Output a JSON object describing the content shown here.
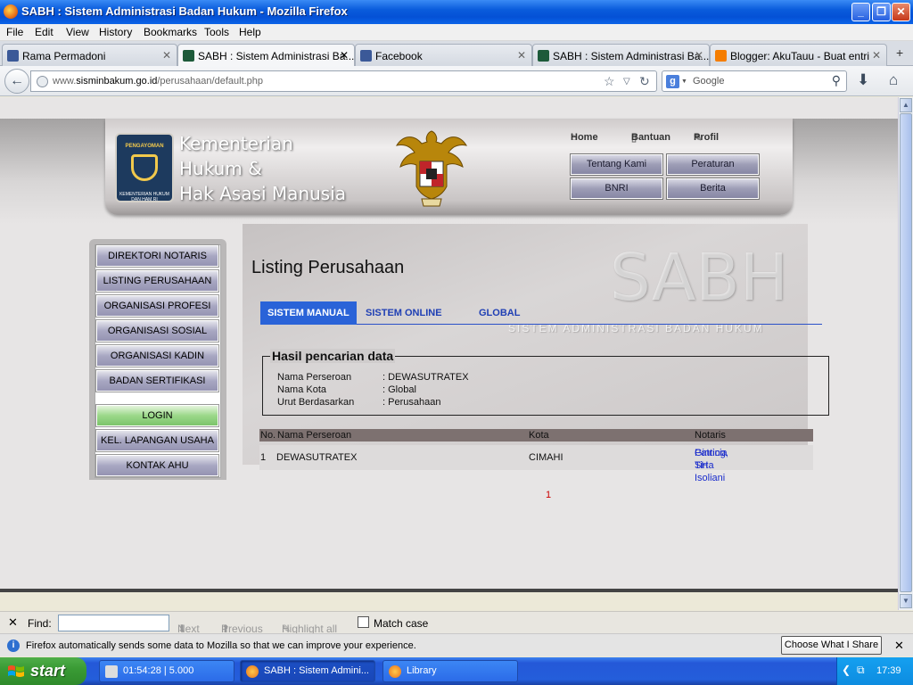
{
  "window": {
    "title": "SABH : Sistem Administrasi Badan Hukum - Mozilla Firefox"
  },
  "menu": [
    "File",
    "Edit",
    "View",
    "History",
    "Bookmarks",
    "Tools",
    "Help"
  ],
  "tabs": [
    {
      "label": "Rama Permadoni",
      "icon": "facebook-icon"
    },
    {
      "label": "SABH : Sistem Administrasi Ba...",
      "icon": "sabh-icon",
      "active": true
    },
    {
      "label": "Facebook",
      "icon": "facebook-icon"
    },
    {
      "label": "SABH : Sistem Administrasi Ba...",
      "icon": "sabh-icon"
    },
    {
      "label": "Blogger: AkuTauu - Buat entri",
      "icon": "blogger-icon"
    }
  ],
  "nav": {
    "url_prefix": "www.",
    "url_domain": "sisminbakum.go.id",
    "url_path": "/perusahaan/default.php",
    "search_placeholder": "Google"
  },
  "site": {
    "title_line1": "Kementerian",
    "title_line2": "Hukum &",
    "title_line3": "Hak Asasi Manusia",
    "logo_top": "PENGAYOMAN",
    "logo_bottom": "KEMENTERIAN HUKUM DAN HAM RI",
    "top_links": {
      "home": "Home",
      "help": "Bantuan",
      "profile": "Profil"
    },
    "header_buttons": {
      "about": "Tentang Kami",
      "rules": "Peraturan",
      "bnri": "BNRI",
      "news": "Berita"
    },
    "watermark": "SABH",
    "watermark_sub": "SISTEM ADMINISTRASI BADAN HUKUM"
  },
  "sidebar": {
    "items": [
      "DIREKTORI NOTARIS",
      "LISTING PERUSAHAAN",
      "ORGANISASI PROFESI",
      "ORGANISASI SOSIAL",
      "ORGANISASI KADIN",
      "BADAN SERTIFIKASI"
    ],
    "login": "LOGIN",
    "kel": "KEL. LAPANGAN USAHA",
    "contact": "KONTAK AHU"
  },
  "main": {
    "page_title": "Listing Perusahaan",
    "subtabs": [
      "SISTEM MANUAL",
      "SISTEM ONLINE",
      "GLOBAL"
    ],
    "result": {
      "legend": "Hasil pencarian data",
      "rows": [
        {
          "label": "Nama Perseroan",
          "value": ": DEWASUTRATEX"
        },
        {
          "label": "Nama Kota",
          "value": ": Global"
        },
        {
          "label": "Urut Berdasarkan",
          "value": ": Perusahaan"
        }
      ]
    },
    "table": {
      "headers": {
        "no": "No.",
        "name": "Nama Perseroan",
        "city": "Kota",
        "notary": "Notaris"
      },
      "row": {
        "no": "1",
        "name": "DEWASUTRATEX",
        "city": "CIMAHI",
        "notary1": "Patricia Tirta Isoliani",
        "notary2": "Ginting, SH"
      }
    },
    "page_number": "1"
  },
  "findbar": {
    "label": "Find:",
    "next": "Next",
    "previous": "Previous",
    "highlight": "Highlight all",
    "match_case": "Match case"
  },
  "notification": {
    "message": "Firefox automatically sends some data to Mozilla so that we can improve your experience.",
    "button": "Choose What I Share"
  },
  "taskbar": {
    "start": "start",
    "items": [
      {
        "label": "01:54:28 | 5.000"
      },
      {
        "label": "SABH : Sistem Admini..."
      },
      {
        "label": "Library"
      }
    ],
    "clock": "17:39"
  },
  "colors": {
    "xp_blue": "#0451d6",
    "start_green": "#3a9b35",
    "active_subtab": "#2a63d8",
    "link": "#1a2ccc"
  }
}
